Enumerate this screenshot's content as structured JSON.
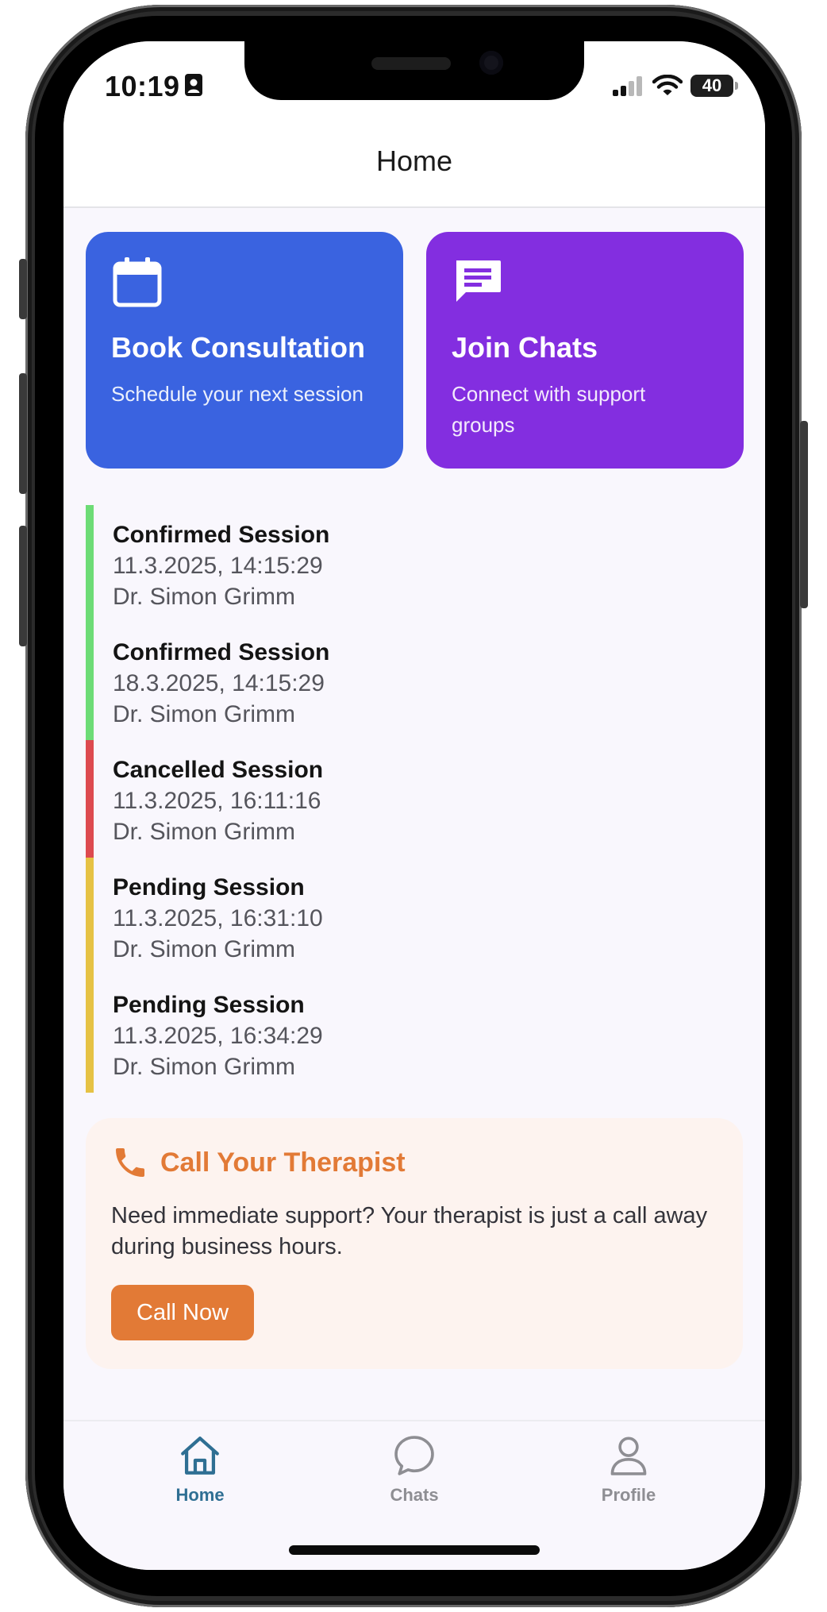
{
  "status_bar": {
    "time": "10:19",
    "battery": "40"
  },
  "header": {
    "title": "Home"
  },
  "actions": {
    "book": {
      "title": "Book Consultation",
      "subtitle": "Schedule your next session",
      "color": "#3a63e0",
      "icon": "calendar-icon"
    },
    "chats": {
      "title": "Join Chats",
      "subtitle": "Connect with support groups",
      "color": "#832ee0",
      "icon": "message-icon"
    }
  },
  "sessions": [
    {
      "title": "Confirmed Session",
      "datetime": "11.3.2025, 14:15:29",
      "doctor": "Dr. Simon Grimm",
      "status_color": "#6ddc76"
    },
    {
      "title": "Confirmed Session",
      "datetime": "18.3.2025, 14:15:29",
      "doctor": "Dr. Simon Grimm",
      "status_color": "#6ddc76"
    },
    {
      "title": "Cancelled Session",
      "datetime": "11.3.2025, 16:11:16",
      "doctor": "Dr. Simon Grimm",
      "status_color": "#dd4a4f"
    },
    {
      "title": "Pending Session",
      "datetime": "11.3.2025, 16:31:10",
      "doctor": "Dr. Simon Grimm",
      "status_color": "#e6c244"
    },
    {
      "title": "Pending Session",
      "datetime": "11.3.2025, 16:34:29",
      "doctor": "Dr. Simon Grimm",
      "status_color": "#e6c244"
    }
  ],
  "call_card": {
    "title": "Call Your Therapist",
    "text": "Need immediate support? Your therapist is just a call away during business hours.",
    "button": "Call Now",
    "accent": "#e27a36",
    "icon": "phone-icon"
  },
  "tabbar": {
    "active_color": "#2f6f93",
    "inactive_color": "#8e8e93",
    "tabs": [
      {
        "label": "Home",
        "icon": "home-icon",
        "active": true
      },
      {
        "label": "Chats",
        "icon": "chat-bubble-icon",
        "active": false
      },
      {
        "label": "Profile",
        "icon": "person-icon",
        "active": false
      }
    ]
  }
}
